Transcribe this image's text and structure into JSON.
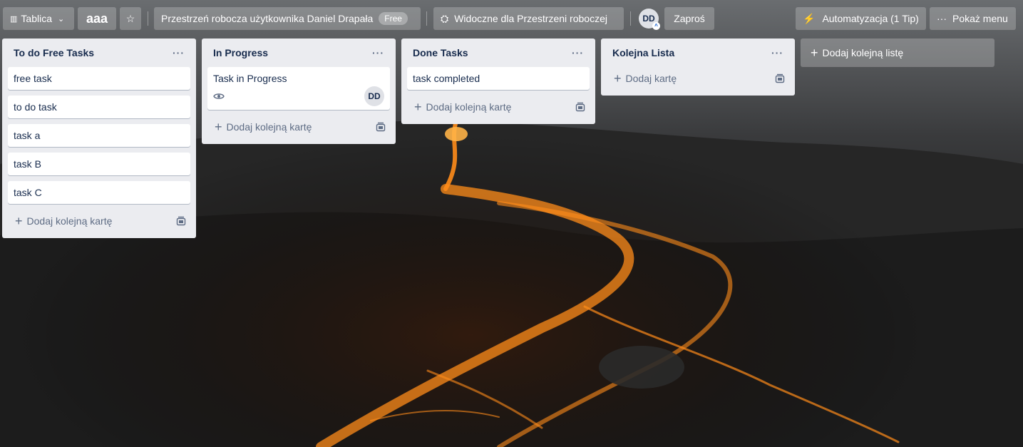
{
  "header": {
    "view_switcher": "Tablica",
    "board_name": "aaa",
    "workspace": "Przestrzeń robocza użytkownika Daniel Drapała",
    "workspace_badge": "Free",
    "visibility": "Widoczne dla Przestrzeni roboczej",
    "member_initials": "DD",
    "invite": "Zaproś",
    "automation": "Automatyzacja (1 Tip)",
    "menu": "Pokaż menu"
  },
  "lists": [
    {
      "title": "To do Free Tasks",
      "cards": [
        "free task",
        "to do task",
        "task a",
        "task B",
        "task C"
      ],
      "add_label": "Dodaj kolejną kartę"
    },
    {
      "title": "In Progress",
      "cards": [
        "Task in Progress"
      ],
      "card_member": "DD",
      "add_label": "Dodaj kolejną kartę"
    },
    {
      "title": "Done Tasks",
      "cards": [
        "task completed"
      ],
      "add_label": "Dodaj kolejną kartę"
    },
    {
      "title": "Kolejna Lista",
      "cards": [],
      "add_label": "Dodaj kartę"
    }
  ],
  "add_list_label": "Dodaj kolejną listę",
  "colors": {
    "list_bg": "#ebecf0",
    "card_bg": "#ffffff",
    "text": "#172b4d",
    "muted": "#5e6c84",
    "lava": "#ff8c1a"
  }
}
